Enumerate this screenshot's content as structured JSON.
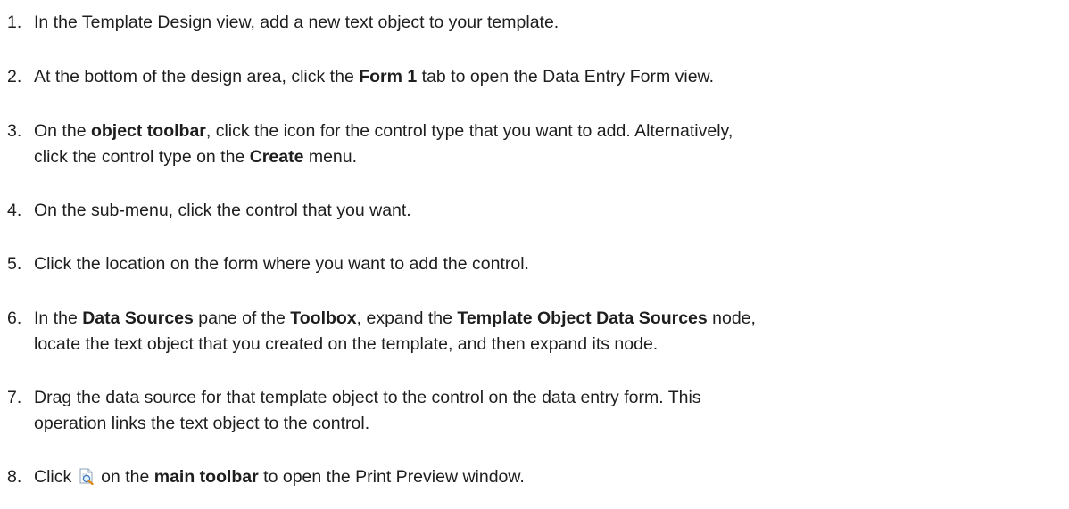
{
  "steps": [
    {
      "number": "1.",
      "lines": [
        [
          {
            "t": "In the Template Design view, add a new text object to your template."
          }
        ]
      ]
    },
    {
      "number": "2.",
      "lines": [
        [
          {
            "t": "At the bottom of the design area, click the "
          },
          {
            "t": "Form 1",
            "b": true
          },
          {
            "t": " tab to open the Data Entry Form view."
          }
        ]
      ]
    },
    {
      "number": "3.",
      "lines": [
        [
          {
            "t": "On the "
          },
          {
            "t": "object toolbar",
            "b": true
          },
          {
            "t": ", click the icon for the control type that you want to add. Alternatively,"
          }
        ],
        [
          {
            "t": "click the control type on the "
          },
          {
            "t": "Create",
            "b": true
          },
          {
            "t": " menu."
          }
        ]
      ]
    },
    {
      "number": "4.",
      "lines": [
        [
          {
            "t": "On the sub-menu, click the control that you want."
          }
        ]
      ]
    },
    {
      "number": "5.",
      "lines": [
        [
          {
            "t": "Click the location on the form where you want to add the control."
          }
        ]
      ]
    },
    {
      "number": "6.",
      "lines": [
        [
          {
            "t": "In the "
          },
          {
            "t": "Data Sources",
            "b": true
          },
          {
            "t": " pane of the "
          },
          {
            "t": "Toolbox",
            "b": true
          },
          {
            "t": ", expand the "
          },
          {
            "t": "Template Object Data Sources",
            "b": true
          },
          {
            "t": " node,"
          }
        ],
        [
          {
            "t": "locate the text object that you created on the template, and then expand its node."
          }
        ]
      ]
    },
    {
      "number": "7.",
      "lines": [
        [
          {
            "t": "Drag the data source for that template object to the control on the data entry form. This"
          }
        ],
        [
          {
            "t": "operation links the text object to the control."
          }
        ]
      ]
    },
    {
      "number": "8.",
      "lines": [
        [
          {
            "t": "Click "
          },
          {
            "icon": "print-preview-icon"
          },
          {
            "t": " on the "
          },
          {
            "t": "main toolbar",
            "b": true
          },
          {
            "t": " to open the Print Preview window."
          }
        ]
      ]
    }
  ]
}
